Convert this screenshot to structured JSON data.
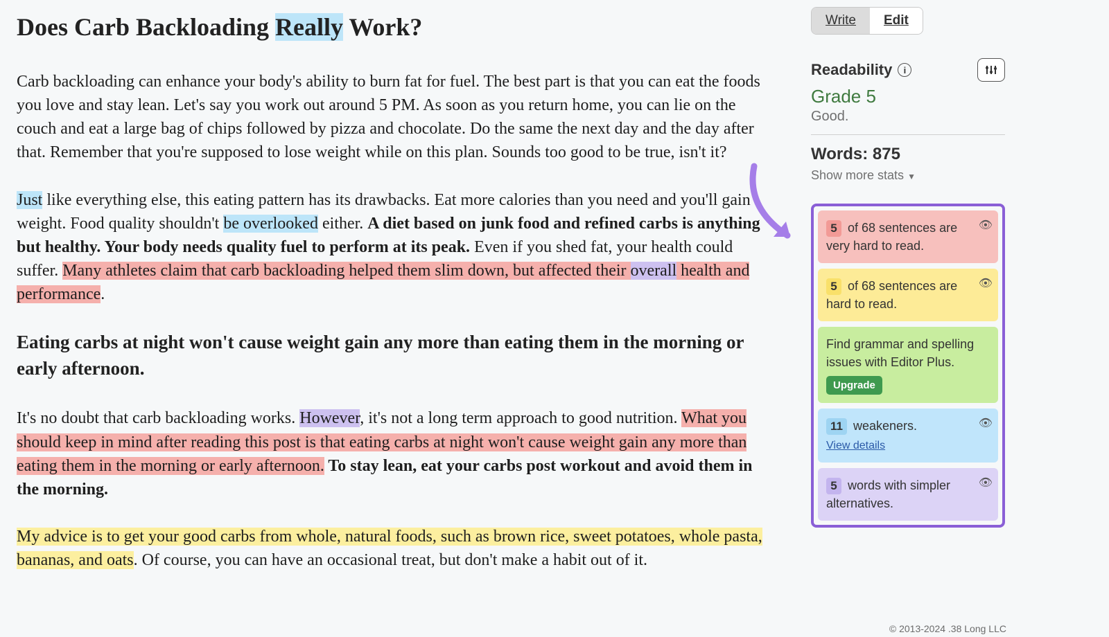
{
  "document": {
    "title_parts": {
      "before": "Does Carb Backloading ",
      "highlight": "Really",
      "after": " Work?"
    },
    "p1": "Carb backloading can enhance your body's ability to burn fat for fuel. The best part is that you can eat the foods you love and stay lean. Let's say you work out around 5 PM. As soon as you return home, you can lie on the couch and eat a large bag of chips followed by pizza and chocolate. Do the same the next day and the day after that. Remember that you're supposed to lose weight while on this plan. Sounds too good to be true, isn't it?",
    "p2": {
      "s1_hl_just": "Just",
      "s1_rest": " like everything else, this eating pattern has its drawbacks. Eat more calories than you need and you'll gain weight. Food quality shouldn't ",
      "s1_hl_overlooked": "be overlooked",
      "s1_tail": " either. ",
      "bold1": "A diet based on junk food and refined carbs is anything but healthy. Your body needs quality fuel to perform at its peak.",
      "s2": " Even if you shed fat, your health could suffer. ",
      "red_a": "Many athletes claim that carb backloading helped them slim down, but affected their ",
      "red_overall": "overall",
      "red_b": " health and performance",
      "period": "."
    },
    "h2": "Eating carbs at night won't cause weight gain any more than eating them in the morning or early afternoon.",
    "p3": {
      "lead": "It's no doubt that carb backloading works. ",
      "however": "However",
      "mid": ", it's not a long term approach to good nutrition. ",
      "red": "What you should keep in mind after reading this post is that eating carbs at night won't cause weight gain any more than eating them in the morning or early afternoon.",
      "bold": " To stay lean, eat your carbs post workout and avoid them in the morning."
    },
    "p4": {
      "yellow": "My advice is to get your good carbs from whole, natural foods, such as brown rice, sweet potatoes, whole pasta, bananas, and oats",
      "tail": ". Of course, you can have an occasional treat, but don't make a habit out of it."
    }
  },
  "sidebar": {
    "tabs": {
      "write": "Write",
      "edit": "Edit"
    },
    "readability_label": "Readability",
    "grade": "Grade 5",
    "good": "Good.",
    "words_label": "Words: ",
    "words_value": "875",
    "show_more": "Show more stats",
    "issues": {
      "veryhard": {
        "count": "5",
        "text": " of 68 sentences are very hard to read."
      },
      "hard": {
        "count": "5",
        "text": " of 68 sentences are hard to read."
      },
      "grammar": {
        "text": "Find grammar and spelling issues with Editor Plus.",
        "upgrade": "Upgrade"
      },
      "weak": {
        "count": "11",
        "text": " weakeners.",
        "view": "View details"
      },
      "simpler": {
        "count": "5",
        "text": " words with simpler alternatives."
      }
    },
    "copyright": "© 2013-2024 .38 Long LLC"
  }
}
